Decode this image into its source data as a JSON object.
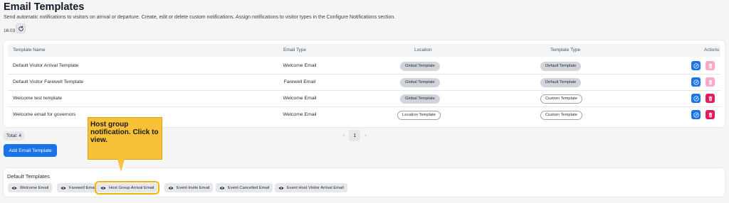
{
  "header": {
    "title": "Email Templates",
    "subtitle": "Send automatic notifications to visitors on arrival or departure. Create, edit or delete custom notifications. Assign notifications to visitor types in the Configure Notifications section.",
    "time": "16:03",
    "refresh_icon": "refresh-icon"
  },
  "table": {
    "columns": [
      "Template Name",
      "Email Type",
      "Location",
      "Template Type",
      "Actions"
    ],
    "rows": [
      {
        "name": "Default Visitor Arrival Template",
        "email_type": "Welcome Email",
        "location": "Global Template",
        "template_type": "Default Template"
      },
      {
        "name": "Default Visitor Farewell Template",
        "email_type": "Farewell Email",
        "location": "Global Template",
        "template_type": "Default Template"
      },
      {
        "name": "Welcome test template",
        "email_type": "Welcome Email",
        "location": "Global Template",
        "template_type": "Custom Template"
      },
      {
        "name": "Welcome email for governors",
        "email_type": "Welcome Email",
        "location": "Location Template",
        "template_type": "Custom Template"
      }
    ]
  },
  "footer": {
    "total": "Total: 4",
    "page": "1",
    "prev": "‹",
    "next": "›",
    "add_button": "Add Email Template"
  },
  "tooltip": {
    "text": "Host group notification. Click to view."
  },
  "defaults": {
    "title": "Default Templates",
    "chips": [
      "Welcome Email",
      "Farewell Email",
      "Host Group Arrival Email",
      "Event Invite Email",
      "Event Cancelled Email",
      "Event Host Visitor Arrival Email"
    ]
  },
  "colors": {
    "primary": "#1a73e8",
    "delete": "#e11d5c",
    "delete_disabled": "#f9a8c8",
    "tooltip": "#f7c238"
  }
}
